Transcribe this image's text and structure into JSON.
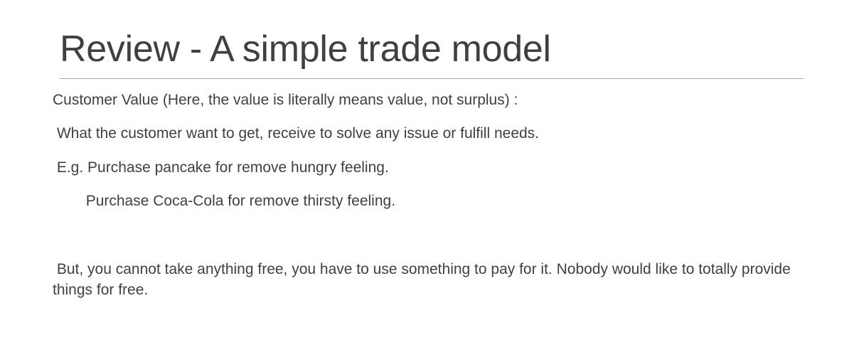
{
  "slide": {
    "title": "Review - A simple trade model",
    "paragraphs": [
      "Customer Value (Here, the value is literally means value, not surplus) :",
      " What the customer want to get, receive to solve any issue or fulfill needs.",
      " E.g. Purchase pancake for remove hungry feeling.",
      "        Purchase Coca-Cola for remove thirsty feeling.",
      " But, you cannot take anything free, you have to use something to pay for it. Nobody would like to totally provide things for free."
    ]
  }
}
